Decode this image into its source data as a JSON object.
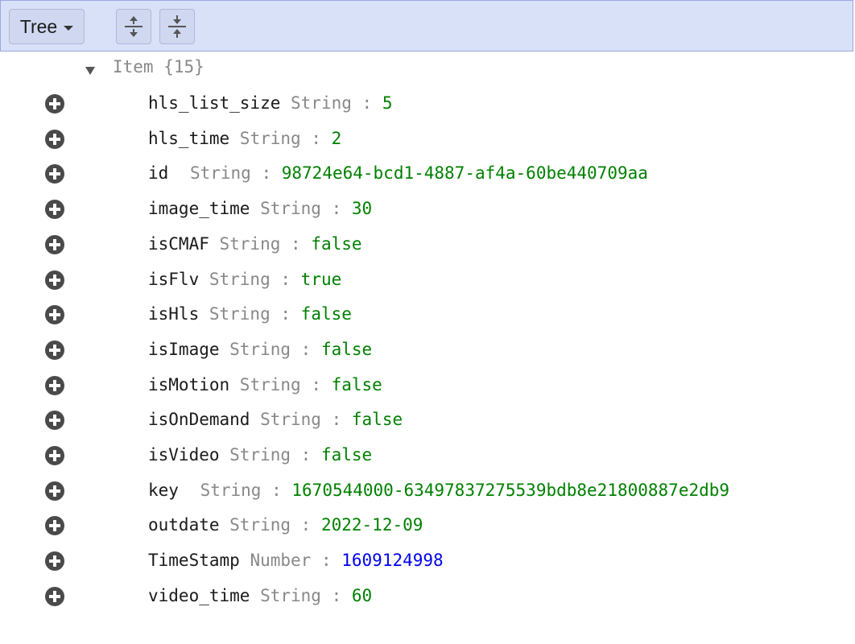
{
  "toolbar": {
    "mode_label": "Tree",
    "expand_all_icon": "expand-all-icon",
    "collapse_all_icon": "collapse-all-icon"
  },
  "tree": {
    "root_label": "Item {15}",
    "fields": [
      {
        "key": "hls_list_size",
        "type": "String",
        "sep": ":",
        "value": "5",
        "value_kind": "string"
      },
      {
        "key": "hls_time",
        "type": "String",
        "sep": ":",
        "value": "2",
        "value_kind": "string"
      },
      {
        "key": "id",
        "type": "String",
        "sep": ":",
        "value": "98724e64-bcd1-4887-af4a-60be440709aa",
        "value_kind": "string"
      },
      {
        "key": "image_time",
        "type": "String",
        "sep": ":",
        "value": "30",
        "value_kind": "string"
      },
      {
        "key": "isCMAF",
        "type": "String",
        "sep": ":",
        "value": "false",
        "value_kind": "string"
      },
      {
        "key": "isFlv",
        "type": "String",
        "sep": ":",
        "value": "true",
        "value_kind": "string"
      },
      {
        "key": "isHls",
        "type": "String",
        "sep": ":",
        "value": "false",
        "value_kind": "string"
      },
      {
        "key": "isImage",
        "type": "String",
        "sep": ":",
        "value": "false",
        "value_kind": "string"
      },
      {
        "key": "isMotion",
        "type": "String",
        "sep": ":",
        "value": "false",
        "value_kind": "string"
      },
      {
        "key": "isOnDemand",
        "type": "String",
        "sep": ":",
        "value": "false",
        "value_kind": "string"
      },
      {
        "key": "isVideo",
        "type": "String",
        "sep": ":",
        "value": "false",
        "value_kind": "string"
      },
      {
        "key": "key",
        "type": "String",
        "sep": ":",
        "value": "1670544000-63497837275539bdb8e21800887e2db9",
        "value_kind": "string"
      },
      {
        "key": "outdate",
        "type": "String",
        "sep": ":",
        "value": "2022-12-09",
        "value_kind": "string"
      },
      {
        "key": "TimeStamp",
        "type": "Number",
        "sep": ":",
        "value": "1609124998",
        "value_kind": "number"
      },
      {
        "key": "video_time",
        "type": "String",
        "sep": ":",
        "value": "60",
        "value_kind": "string"
      }
    ]
  },
  "colors": {
    "toolbar_bg": "#d9e1f9",
    "string_value": "#008000",
    "number_value": "#0000ee",
    "type_label": "#888888"
  }
}
